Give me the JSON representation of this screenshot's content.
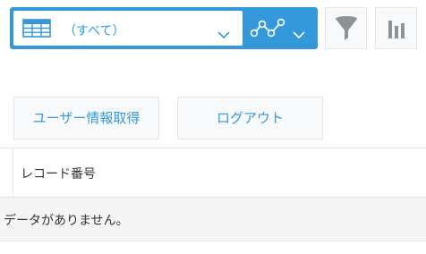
{
  "view_selector": {
    "selected_view": "（すべて）",
    "icon": "table-icon"
  },
  "graph_selector": {
    "icon": "line-graph-icon"
  },
  "toolbar": {
    "filter_icon": "funnel-icon",
    "graph_icon": "bar-chart-icon"
  },
  "actions": {
    "user_info_label": "ユーザー情報取得",
    "logout_label": "ログアウト"
  },
  "grid": {
    "columns": [
      "レコード番号"
    ],
    "empty_message": "データがありません。"
  },
  "colors": {
    "accent": "#3498db",
    "button_bg": "#f7f9fa",
    "border": "#e3e7e8",
    "empty_row_bg": "#f5f5f5",
    "icon_gray": "#8d9293"
  }
}
